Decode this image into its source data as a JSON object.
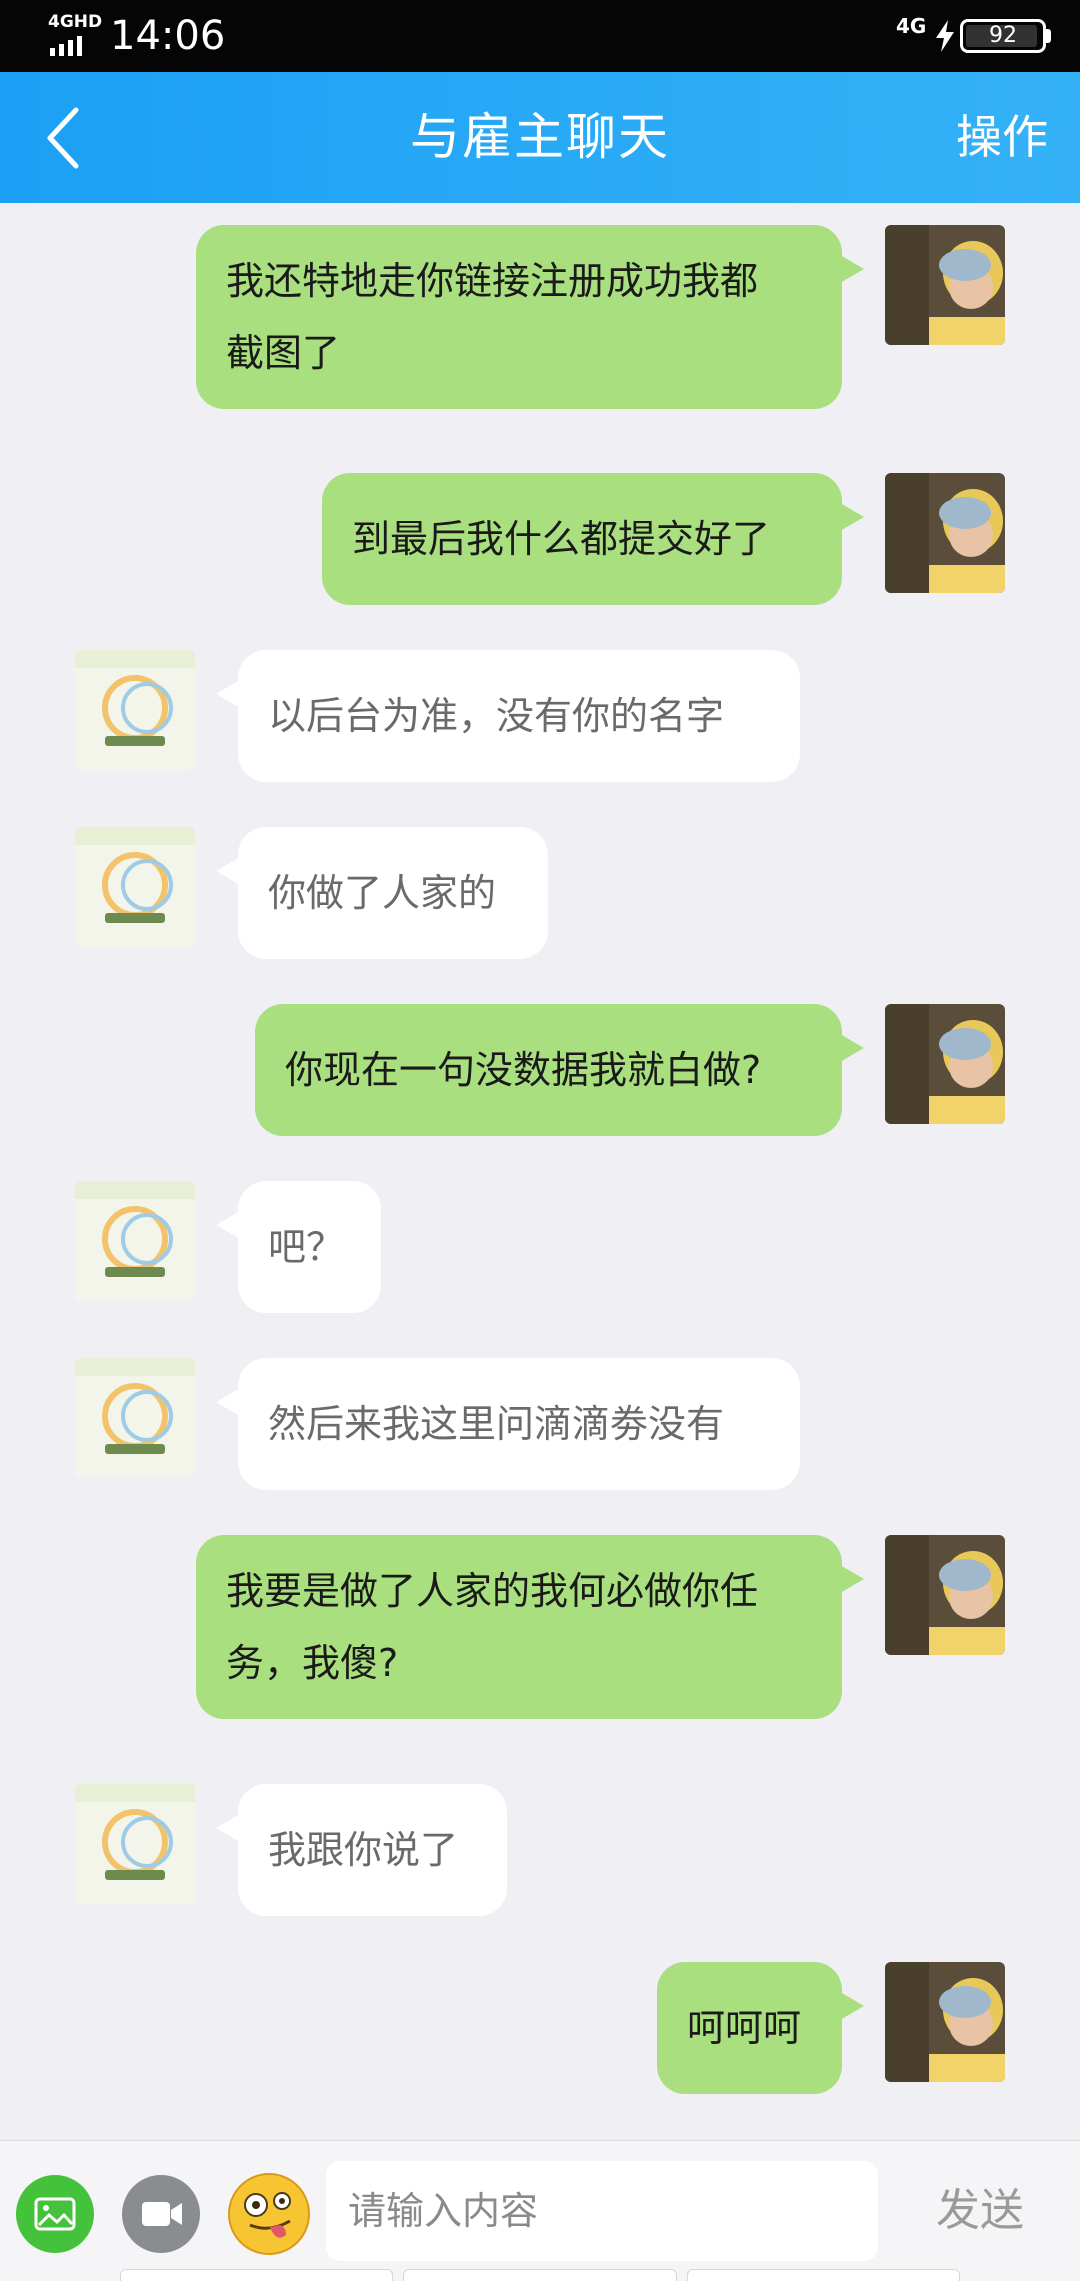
{
  "status_bar": {
    "network_type": "4GHD",
    "time": "14:06",
    "secondary_network": "4G",
    "battery_level": "92"
  },
  "header": {
    "title": "与雇主聊天",
    "action_label": "操作",
    "background_colors": [
      "#1ba0f5",
      "#35b2f7"
    ]
  },
  "messages": [
    {
      "sender": "self",
      "text": "我还特地走你链接注册成功我都截图了",
      "lines": [
        "我还特地走你链接注册成功我都",
        "截图了"
      ]
    },
    {
      "sender": "self",
      "text": "到最后我什么都提交好了"
    },
    {
      "sender": "other",
      "text": "以后台为准，没有你的名字"
    },
    {
      "sender": "other",
      "text": "你做了人家的"
    },
    {
      "sender": "self",
      "text": "你现在一句没数据我就白做?"
    },
    {
      "sender": "other",
      "text": "吧？"
    },
    {
      "sender": "other",
      "text": "然后来我这里问滴滴劵没有"
    },
    {
      "sender": "self",
      "text": "我要是做了人家的我何必做你任务，我傻?",
      "lines": [
        "我要是做了人家的我何必做你任",
        "务，我傻?"
      ]
    },
    {
      "sender": "other",
      "text": "我跟你说了"
    },
    {
      "sender": "self",
      "text": "呵呵呵"
    }
  ],
  "input_bar": {
    "placeholder": "请输入内容",
    "value": "",
    "send_label": "发送"
  },
  "colors": {
    "self_bubble": "#a9df7e",
    "other_bubble": "#ffffff",
    "background": "#efeff4"
  }
}
